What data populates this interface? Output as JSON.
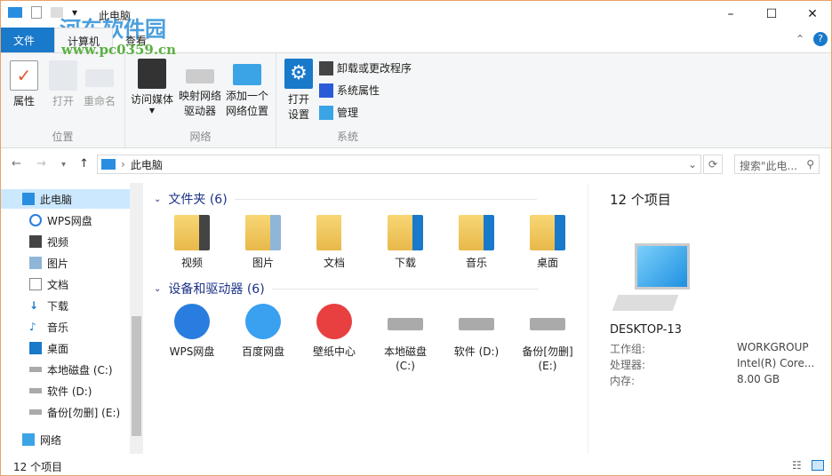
{
  "window": {
    "title": "此电脑",
    "minimize": "–",
    "maximize": "☐",
    "close": "✕"
  },
  "watermark": {
    "name": "河东软件园",
    "url": "www.pc0359.cn"
  },
  "tabs": [
    {
      "label": "文件"
    },
    {
      "label": "计算机"
    },
    {
      "label": "查看"
    }
  ],
  "ribbon": {
    "location": {
      "label": "位置",
      "buttons": [
        "属性",
        "打开",
        "重命名"
      ]
    },
    "network": {
      "label": "网络",
      "buttons": [
        "访问媒体",
        "映射网络\n驱动器",
        "添加一个\n网络位置"
      ]
    },
    "system": {
      "label": "系统",
      "open_settings": "打开\n设置",
      "small": [
        "卸载或更改程序",
        "系统属性",
        "管理"
      ]
    }
  },
  "address": {
    "path": "此电脑",
    "search_placeholder": "搜索\"此电...",
    "back": "←",
    "forward": "→",
    "up": "↑",
    "refresh": "⟳"
  },
  "nav": [
    {
      "label": "此电脑"
    },
    {
      "label": "WPS网盘"
    },
    {
      "label": "视频"
    },
    {
      "label": "图片"
    },
    {
      "label": "文档"
    },
    {
      "label": "下载"
    },
    {
      "label": "音乐"
    },
    {
      "label": "桌面"
    },
    {
      "label": "本地磁盘 (C:)"
    },
    {
      "label": "软件 (D:)"
    },
    {
      "label": "备份[勿删] (E:)"
    },
    {
      "label": "网络"
    }
  ],
  "folders": {
    "header": "文件夹 (6)",
    "items": [
      "视频",
      "图片",
      "文档",
      "下载",
      "音乐",
      "桌面"
    ]
  },
  "devices": {
    "header": "设备和驱动器 (6)",
    "items": [
      "WPS网盘",
      "百度网盘",
      "壁纸中心",
      "本地磁盘\n(C:)",
      "软件 (D:)",
      "备份[勿删]\n(E:)"
    ]
  },
  "details": {
    "count": "12 个项目",
    "name": "DESKTOP-13",
    "rows": [
      {
        "k": "工作组:",
        "v": "WORKGROUP"
      },
      {
        "k": "处理器:",
        "v": "Intel(R) Core..."
      },
      {
        "k": "内存:",
        "v": "8.00 GB"
      }
    ]
  },
  "status": "12 个项目"
}
